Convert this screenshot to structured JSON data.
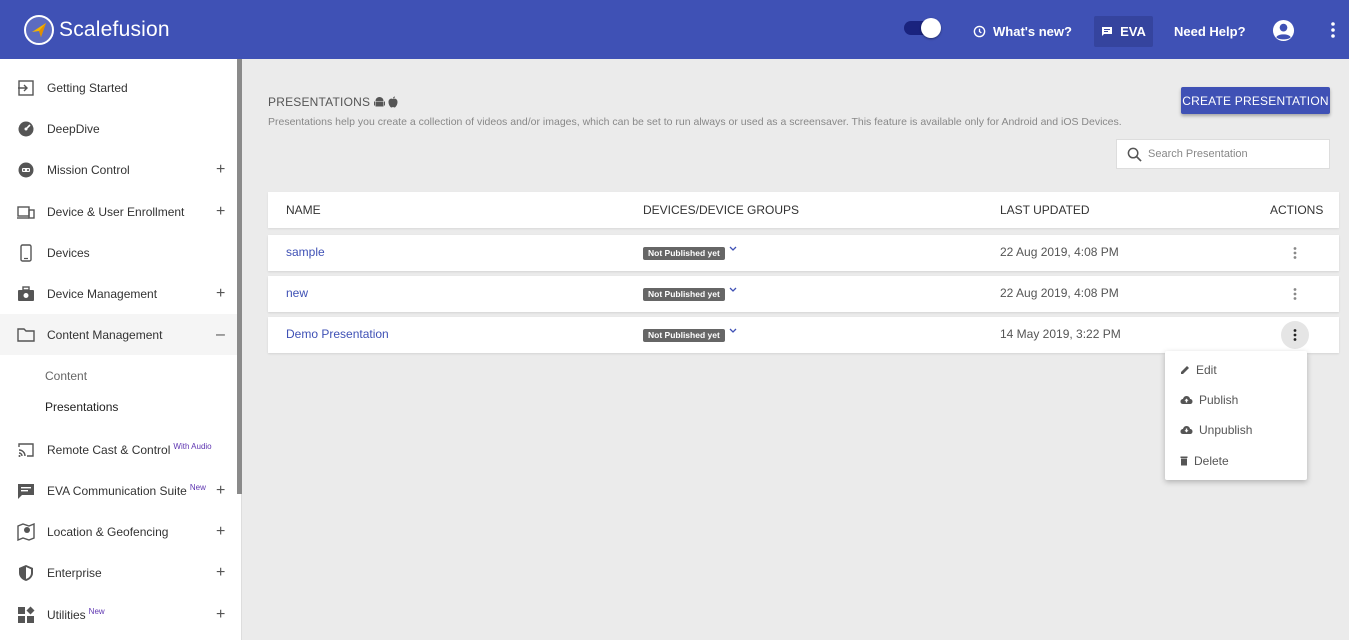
{
  "app": {
    "brand": "Scalefusion",
    "whats_new": "What's new?",
    "eva": "EVA",
    "need_help": "Need Help?"
  },
  "sidebar": {
    "items": [
      {
        "label": "Getting Started",
        "icon": "exit-to-app-icon"
      },
      {
        "label": "DeepDive",
        "icon": "speedometer-icon"
      },
      {
        "label": "Mission Control",
        "icon": "robot-icon",
        "expandable": "+"
      },
      {
        "label": "Device & User Enrollment",
        "icon": "devices-icon",
        "expandable": "+"
      },
      {
        "label": "Devices",
        "icon": "phone-icon"
      },
      {
        "label": "Device Management",
        "icon": "briefcase-icon",
        "expandable": "+"
      },
      {
        "label": "Content Management",
        "icon": "folder-icon",
        "expandable": "–"
      },
      {
        "label": "Remote Cast & Control",
        "icon": "cast-icon",
        "tag": "With Audio"
      },
      {
        "label": "EVA Communication Suite",
        "icon": "chat-icon",
        "tag": "New",
        "expandable": "+"
      },
      {
        "label": "Location & Geofencing",
        "icon": "map-marker-icon",
        "expandable": "+"
      },
      {
        "label": "Enterprise",
        "icon": "shield-icon",
        "expandable": "+"
      },
      {
        "label": "Utilities",
        "icon": "widgets-icon",
        "tag": "New",
        "expandable": "+"
      }
    ],
    "sub_items": [
      "Content",
      "Presentations"
    ]
  },
  "main": {
    "title": "PRESENTATIONS",
    "description": "Presentations help you create a collection of videos and/or images, which can be set to run always or used as a screensaver. This feature is available only for Android and iOS Devices.",
    "create_button": "CREATE PRESENTATION",
    "search_placeholder": "Search Presentation",
    "columns": [
      "NAME",
      "DEVICES/DEVICE GROUPS",
      "LAST UPDATED",
      "ACTIONS"
    ],
    "rows": [
      {
        "name": "sample",
        "status": "Not Published yet",
        "updated": "22 Aug 2019, 4:08 PM"
      },
      {
        "name": "new",
        "status": "Not Published yet",
        "updated": "22 Aug 2019, 4:08 PM"
      },
      {
        "name": "Demo Presentation",
        "status": "Not Published yet",
        "updated": "14 May 2019, 3:22 PM"
      }
    ],
    "menu": [
      "Edit",
      "Publish",
      "Unpublish",
      "Delete"
    ]
  },
  "colors": {
    "primary": "#3f51b5",
    "link": "#3f51b5",
    "badge": "#666666",
    "tag": "#5e35b1"
  }
}
